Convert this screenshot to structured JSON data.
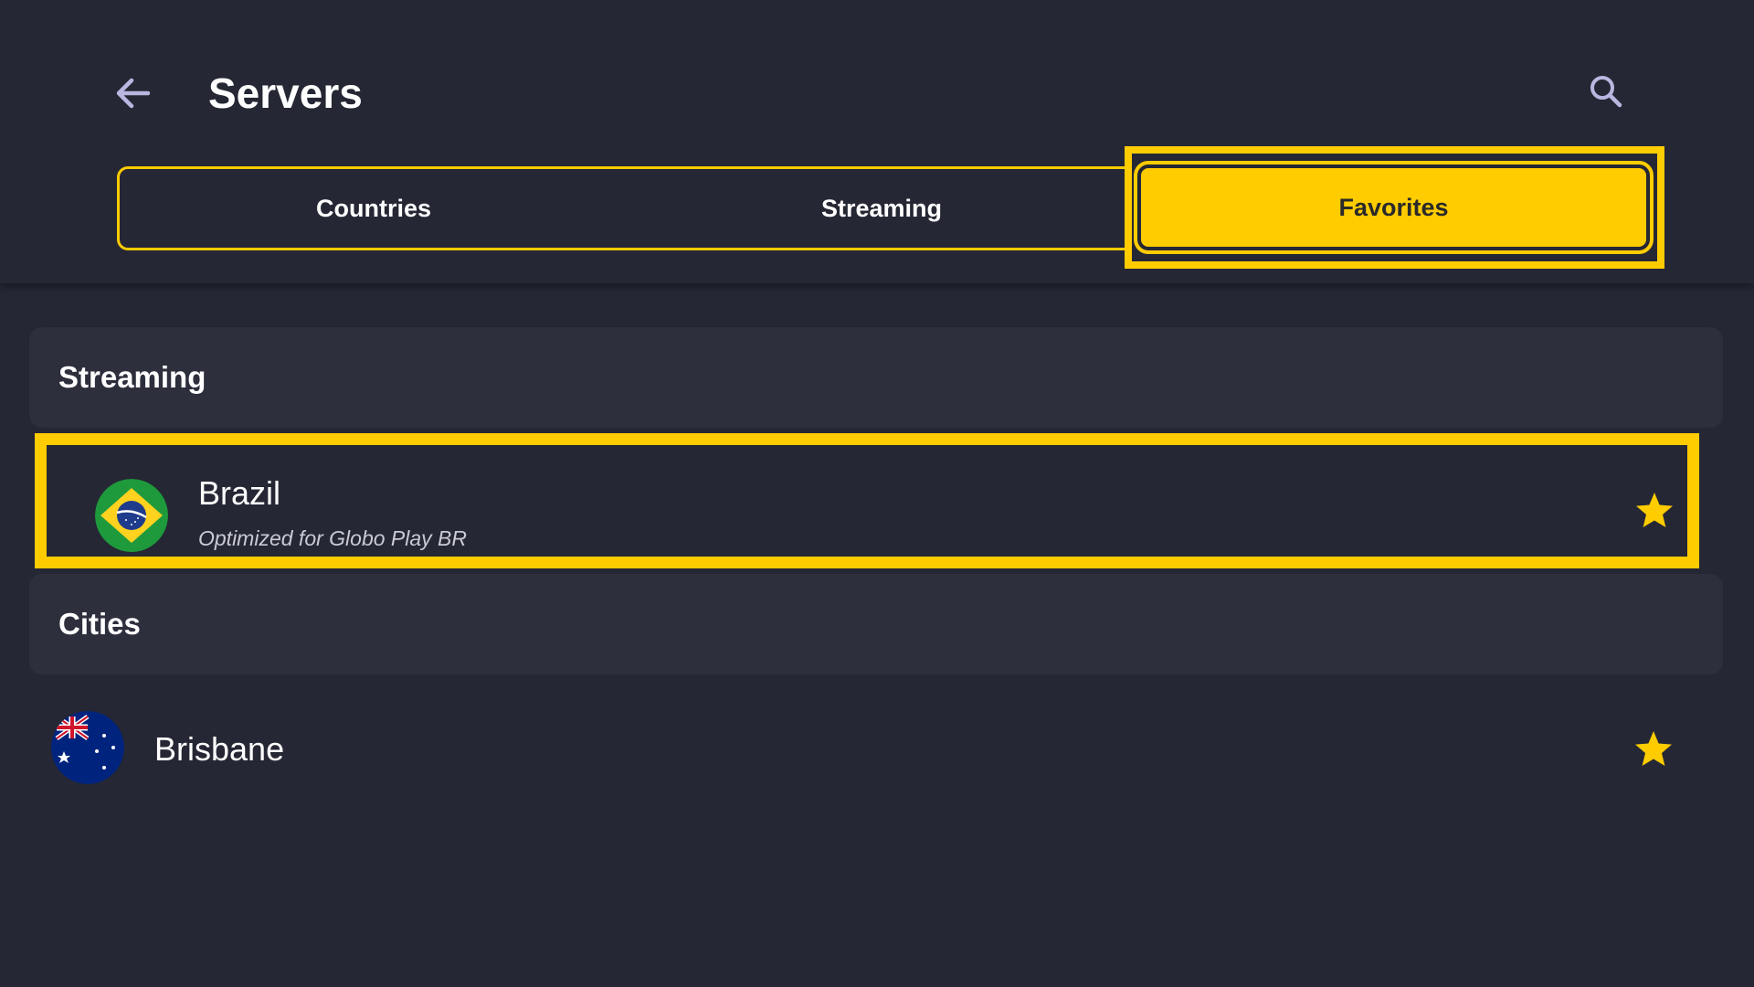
{
  "header": {
    "title": "Servers",
    "back_icon": "arrow-left-icon",
    "search_icon": "search-icon"
  },
  "tabs": [
    {
      "label": "Countries",
      "selected": false
    },
    {
      "label": "Streaming",
      "selected": false
    },
    {
      "label": "Favorites",
      "selected": true
    }
  ],
  "sections": {
    "streaming": {
      "title": "Streaming",
      "items": [
        {
          "name": "Brazil",
          "subtitle": "Optimized for Globo Play BR",
          "flag": "brazil-flag-icon",
          "favorite": true,
          "focused": true
        }
      ]
    },
    "cities": {
      "title": "Cities",
      "items": [
        {
          "name": "Brisbane",
          "flag": "australia-flag-icon",
          "favorite": true,
          "focused": false
        }
      ]
    }
  },
  "colors": {
    "background": "#252734",
    "section_background": "#2d2f3d",
    "accent": "#ffcc00",
    "text": "#ffffff",
    "subtext": "#c9cad3"
  }
}
